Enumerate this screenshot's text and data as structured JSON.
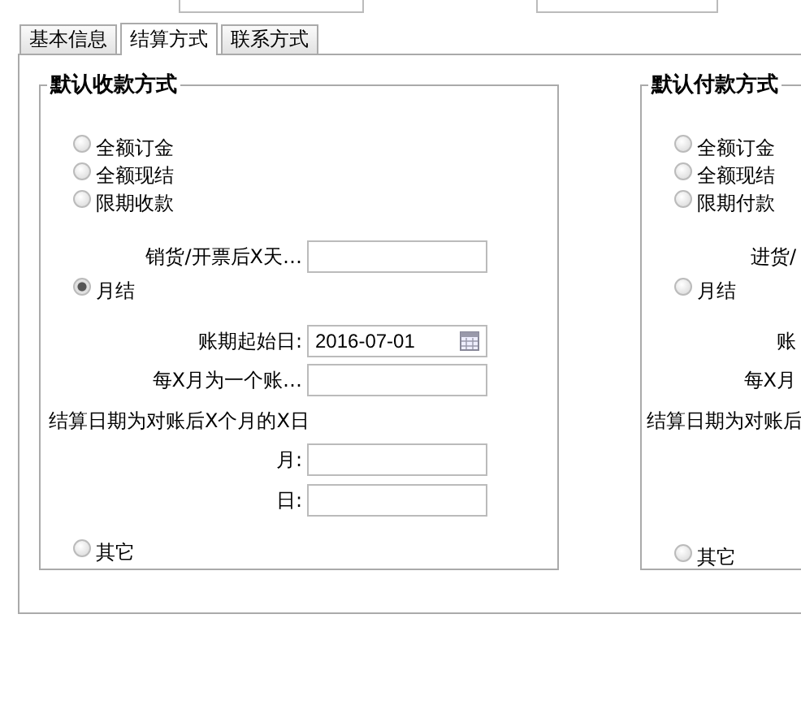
{
  "tabs": [
    {
      "label": "基本信息",
      "selected": false
    },
    {
      "label": "结算方式",
      "selected": true
    },
    {
      "label": "联系方式",
      "selected": false
    }
  ],
  "receive": {
    "legend": "默认收款方式",
    "radios": [
      {
        "label": "全额订金",
        "selected": false
      },
      {
        "label": "全额现结",
        "selected": false
      },
      {
        "label": "限期收款",
        "selected": false
      }
    ],
    "days_label": "销货/开票后X天…",
    "monthly": {
      "label": "月结",
      "selected": true
    },
    "start_label": "账期起始日:",
    "start_value": "2016-07-01",
    "period_label": "每X月为一个账…",
    "settle_note": "结算日期为对账后X个月的X日",
    "month_label": "月:",
    "day_label": "日:",
    "other": {
      "label": "其它",
      "selected": false
    }
  },
  "pay": {
    "legend": "默认付款方式",
    "radios": [
      {
        "label": "全额订金",
        "selected": false
      },
      {
        "label": "全额现结",
        "selected": false
      },
      {
        "label": "限期付款",
        "selected": false
      }
    ],
    "days_label": "进货/",
    "monthly": {
      "label": "月结",
      "selected": false
    },
    "start_label": "账",
    "period_label": "每X月",
    "settle_note": "结算日期为对账后",
    "other": {
      "label": "其它",
      "selected": false
    }
  }
}
